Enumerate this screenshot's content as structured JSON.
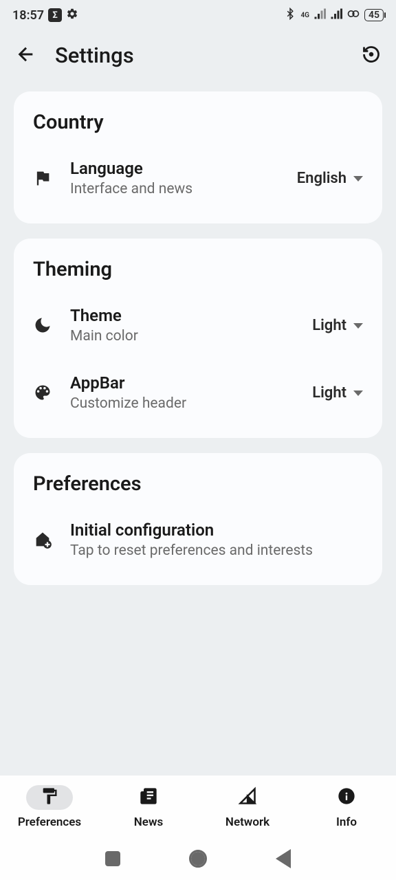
{
  "status": {
    "time": "18:57",
    "battery": "45",
    "network_label": "4G"
  },
  "header": {
    "title": "Settings"
  },
  "sections": {
    "country": {
      "title": "Country",
      "language": {
        "title": "Language",
        "subtitle": "Interface and news",
        "value": "English"
      }
    },
    "theming": {
      "title": "Theming",
      "theme": {
        "title": "Theme",
        "subtitle": "Main color",
        "value": "Light"
      },
      "appbar": {
        "title": "AppBar",
        "subtitle": "Customize header",
        "value": "Light"
      }
    },
    "preferences": {
      "title": "Preferences",
      "initial": {
        "title": "Initial configuration",
        "subtitle": "Tap to reset preferences and interests"
      }
    }
  },
  "nav": {
    "preferences": "Preferences",
    "news": "News",
    "network": "Network",
    "info": "Info"
  }
}
